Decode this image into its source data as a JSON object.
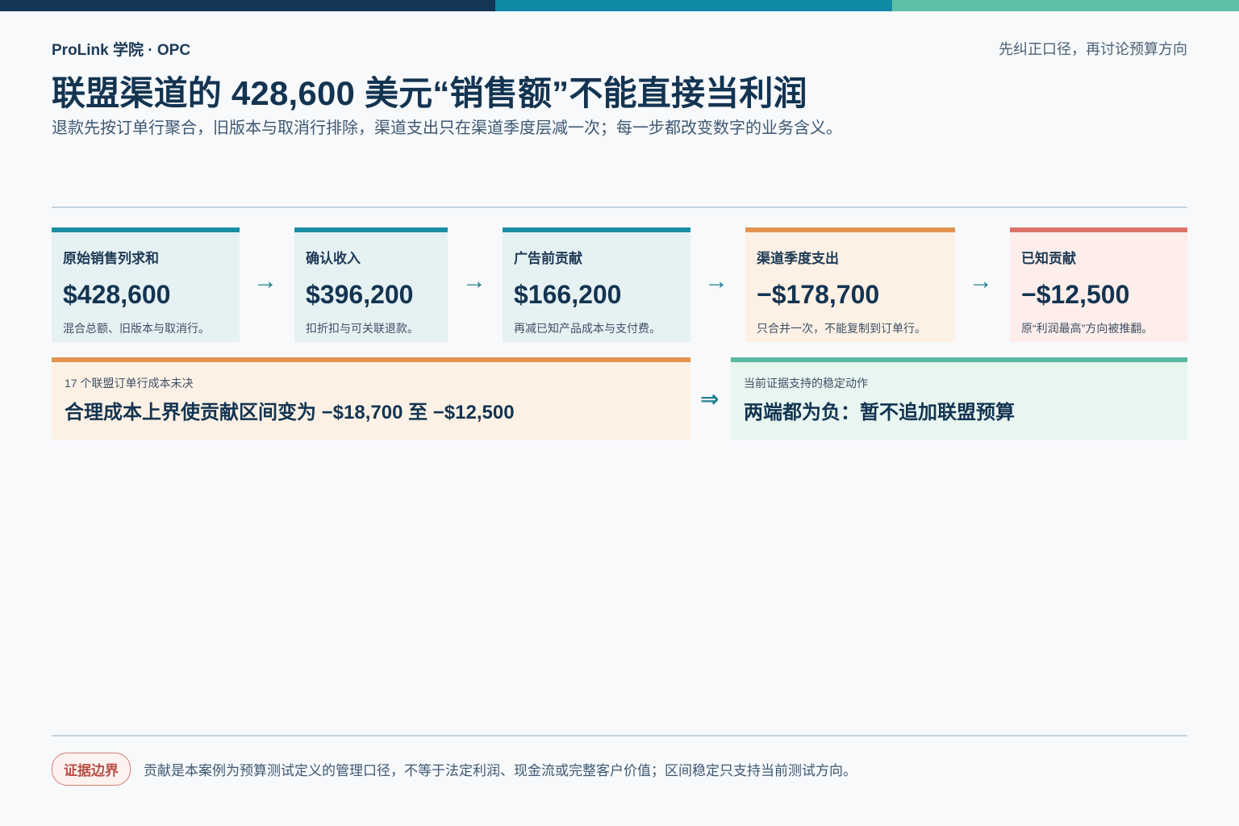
{
  "colors": {
    "topbar": [
      "#143758",
      "#1089a6",
      "#5ec0a6"
    ],
    "teal": "#1b8ea4",
    "orange": "#e39350",
    "red": "#dc7368",
    "green": "#5bb8a0",
    "navy": "#133451"
  },
  "header": {
    "brand": "ProLink 学院 · OPC",
    "note": "先纠正口径，再讨论预算方向",
    "title": "联盟渠道的 428,600 美元“销售额”不能直接当利润",
    "subtitle": "退款先按订单行聚合，旧版本与取消行排除，渠道支出只在渠道季度层减一次；每一步都改变数字的业务含义。"
  },
  "steps": [
    {
      "label": "原始销售列求和",
      "value": "$428,600",
      "note": "混合总额、旧版本与取消行。",
      "tone": "teal"
    },
    {
      "label": "确认收入",
      "value": "$396,200",
      "note": "扣折扣与可关联退款。",
      "tone": "teal"
    },
    {
      "label": "广告前贡献",
      "value": "$166,200",
      "note": "再减已知产品成本与支付费。",
      "tone": "teal"
    },
    {
      "label": "渠道季度支出",
      "value": "−$178,700",
      "note": "只合并一次，不能复制到订单行。",
      "tone": "orange"
    },
    {
      "label": "已知贡献",
      "value": "−$12,500",
      "note": "原“利润最高”方向被推翻。",
      "tone": "red"
    }
  ],
  "arrow_glyph": "→",
  "double_arrow_glyph": "⇒",
  "range_box": {
    "small": "17 个联盟订单行成本未决",
    "big": "合理成本上界使贡献区间变为 −$18,700 至 −$12,500"
  },
  "action_box": {
    "small": "当前证据支持的稳定动作",
    "big": "两端都为负：暂不追加联盟预算"
  },
  "footer": {
    "badge": "证据边界",
    "note": "贡献是本案例为预算测试定义的管理口径，不等于法定利润、现金流或完整客户价值；区间稳定只支持当前测试方向。"
  }
}
